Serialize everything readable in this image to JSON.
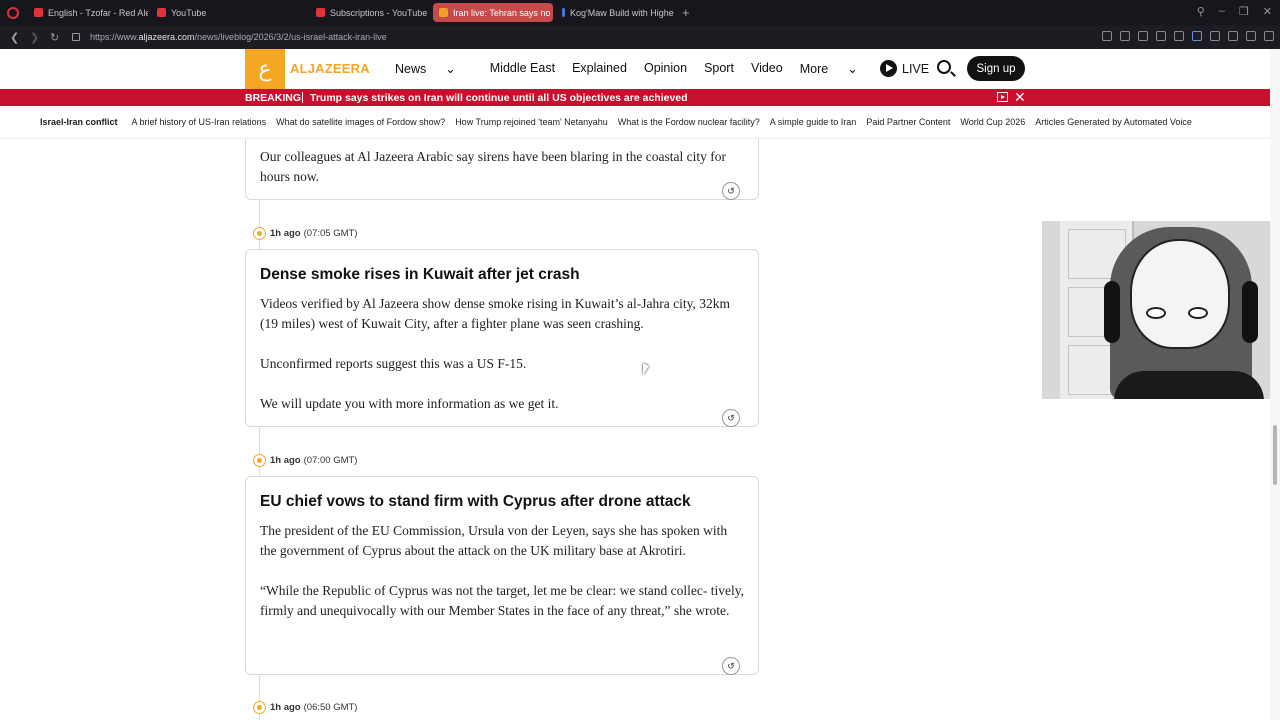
{
  "browser": {
    "tabs": [
      {
        "label": "English - Tzofar - Red Aler",
        "active": false
      },
      {
        "label": "YouTube",
        "active": false
      },
      {
        "label": "Subscriptions - YouTube",
        "active": false
      },
      {
        "label": "Iran live: Tehran says no t",
        "active": true
      },
      {
        "label": "Kog'Maw Build with Highe",
        "active": false
      }
    ],
    "new_tab": "+",
    "url_prefix": "https://www.",
    "url_domain": "aljazeera.com",
    "url_path": "/news/liveblog/2026/3/2/us-israel-attack-iran-live"
  },
  "site": {
    "logo_text": "ALJAZEERA",
    "nav": [
      "News",
      "Middle East",
      "Explained",
      "Opinion",
      "Sport",
      "Video",
      "More"
    ],
    "live_label": "LIVE",
    "signup_label": "Sign up",
    "brand_color": "#f5a623"
  },
  "breaking": {
    "label": "BREAKING",
    "message": "Trump says strikes on Iran will continue until all US objectives are achieved",
    "color": "#c8102e"
  },
  "topics": {
    "first": "Israel-Iran conflict",
    "items": [
      "A brief history of US-Iran relations",
      "What do satellite images of Fordow show?",
      "How Trump rejoined 'team' Netanyahu",
      "What is the Fordow nuclear facility?",
      "A simple guide to Iran",
      "Paid Partner Content",
      "World Cup 2026",
      "Articles Generated by Automated Voice"
    ]
  },
  "posts": [
    {
      "paragraphs": [
        "Our colleagues at Al Jazeera Arabic say sirens have been blaring in the coastal city for hours now."
      ]
    },
    {
      "time_ago": "1h ago",
      "time_gmt": "(07:05 GMT)",
      "title": "Dense smoke rises in Kuwait after jet crash",
      "paragraphs": [
        "Videos verified by Al Jazeera show dense smoke rising in Kuwait’s al-Jahra city, 32km (19 miles) west of Kuwait City, after a fighter plane was seen crashing.",
        "Unconfirmed reports suggest this was a US F-15.",
        "We will update you with more information as we get it."
      ]
    },
    {
      "time_ago": "1h ago",
      "time_gmt": "(07:00 GMT)",
      "title": "EU chief vows to stand firm with Cyprus after drone attack",
      "paragraphs": [
        "The president of the EU Commission, Ursula von der Leyen, says she has spoken with the government of Cyprus about the attack on the UK military base at Akrotiri.",
        "“While the Republic of Cyprus was not the target, let me be clear: we stand collec- tively, firmly and unequivocally with our Member States in the face of any threat,” she wrote."
      ]
    },
    {
      "time_ago": "1h ago",
      "time_gmt": "(06:50 GMT)"
    }
  ]
}
